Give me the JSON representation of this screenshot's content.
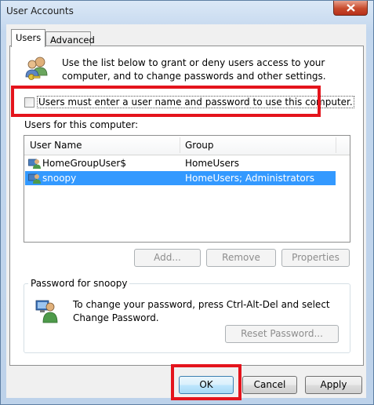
{
  "window": {
    "title": "User Accounts"
  },
  "tabs": [
    {
      "label": "Users"
    },
    {
      "label": "Advanced"
    }
  ],
  "intro": {
    "text": "Use the list below to grant or deny users access to your computer, and to change passwords and other settings."
  },
  "require_login": {
    "label": "Users must enter a user name and password to use this computer.",
    "checked": false
  },
  "users_section": {
    "label": "Users for this computer:"
  },
  "list": {
    "columns": [
      "User Name",
      "Group"
    ],
    "rows": [
      {
        "name": "HomeGroupUser$",
        "group": "HomeUsers",
        "selected": false
      },
      {
        "name": "snoopy",
        "group": "HomeUsers; Administrators",
        "selected": true
      }
    ]
  },
  "user_buttons": {
    "add": "Add...",
    "remove": "Remove",
    "properties": "Properties"
  },
  "password_group": {
    "title": "Password for snoopy",
    "text": "To change your password, press Ctrl-Alt-Del and select Change Password.",
    "reset_button": "Reset Password..."
  },
  "dialog_buttons": {
    "ok": "OK",
    "cancel": "Cancel",
    "apply": "Apply"
  },
  "colors": {
    "highlight": "#e4141c",
    "selection": "#3399ff"
  },
  "icons": [
    "close-icon",
    "users-keys-icon",
    "user-icon",
    "user-password-icon"
  ]
}
